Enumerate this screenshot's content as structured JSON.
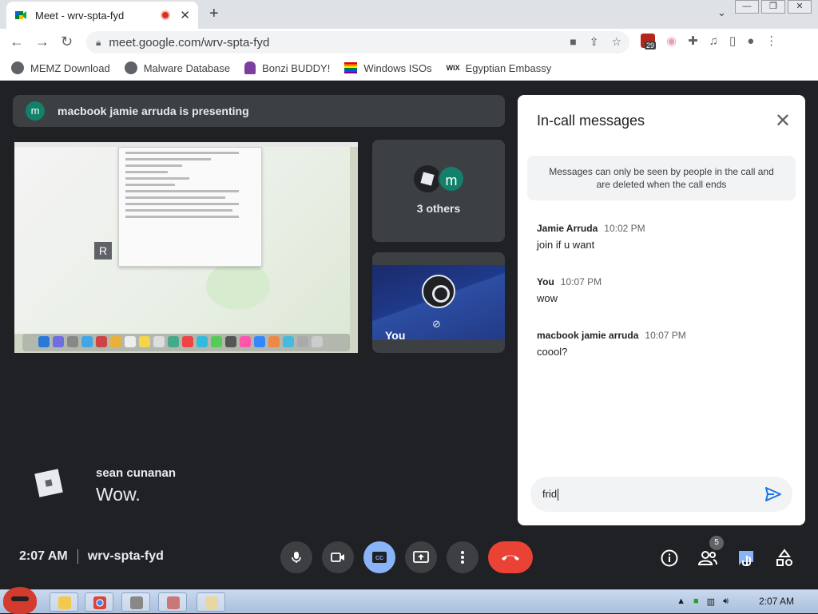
{
  "browser": {
    "tab_title": "Meet - wrv-spta-fyd",
    "new_tab": "+",
    "url": "meet.google.com/wrv-spta-fyd",
    "extension_badge": "29",
    "bookmarks": [
      {
        "label": "MEMZ Download",
        "icon": "globe-icon"
      },
      {
        "label": "Malware Database",
        "icon": "globe-icon"
      },
      {
        "label": "Bonzi BUDDY!",
        "icon": "bonzi-icon"
      },
      {
        "label": "Windows ISOs",
        "icon": "rainbow-flag-icon"
      },
      {
        "label": "Egyptian Embassy",
        "icon": "wix-icon"
      }
    ]
  },
  "meet": {
    "presenting": {
      "avatar": "m",
      "text": "macbook jamie arruda is presenting"
    },
    "others": {
      "avatar_letter": "m",
      "label": "3 others"
    },
    "you_label": "You",
    "caption": {
      "speaker": "sean cunanan",
      "text": "Wow."
    },
    "time": "2:07 AM",
    "room": "wrv-spta-fyd",
    "people_count": "5"
  },
  "chat": {
    "title": "In-call messages",
    "notice": "Messages can only be seen by people in the call and are deleted when the call ends",
    "messages": [
      {
        "sender": "Jamie Arruda",
        "time": "10:02 PM",
        "text": "join if u want"
      },
      {
        "sender": "You",
        "time": "10:07 PM",
        "text": "wow"
      },
      {
        "sender": "macbook jamie arruda",
        "time": "10:07 PM",
        "text": "coool?"
      }
    ],
    "input_value": "frid"
  },
  "taskbar": {
    "clock": "2:07 AM"
  },
  "colors": {
    "accent_blue": "#1a73e8",
    "end_call_red": "#ea4335",
    "meet_bg": "#202124",
    "avatar_green": "#12806a"
  }
}
